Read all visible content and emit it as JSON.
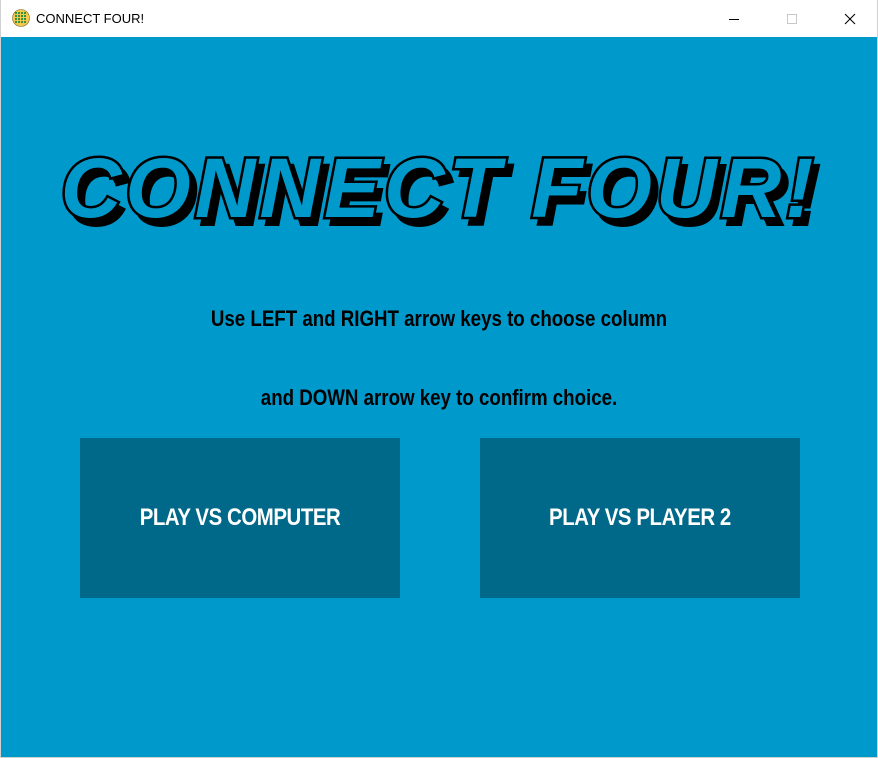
{
  "window": {
    "title": "CONNECT FOUR!",
    "controls": {
      "minimize_icon": "minimize-icon",
      "maximize_icon": "maximize-icon",
      "close_icon": "close-icon"
    }
  },
  "main": {
    "logo_text": "CONNECT FOUR!",
    "instructions": {
      "line1": "Use LEFT and RIGHT arrow keys to choose column",
      "line2": "and DOWN arrow key to confirm choice."
    },
    "buttons": {
      "play_vs_computer": "PLAY VS COMPUTER",
      "play_vs_player2": "PLAY VS PLAYER 2"
    }
  },
  "colors": {
    "background": "#0099cc",
    "button": "#006888",
    "button_text": "#ffffff",
    "text": "#000000"
  }
}
